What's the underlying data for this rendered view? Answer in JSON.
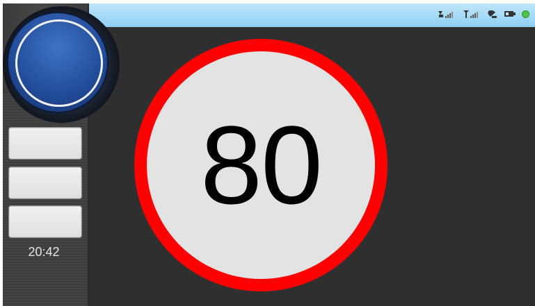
{
  "status_bar": {
    "icons": [
      "satellite-signal-icon",
      "antenna-signal-icon",
      "satellite-dish-icon",
      "battery-icon",
      "gps-fix-dot-icon"
    ],
    "gps_color": "#4fc24a",
    "background": "#8ecff3"
  },
  "sidebar": {
    "home_button_icon": "circle-ring-icon",
    "buttons": [
      "",
      "",
      ""
    ],
    "clock": "20:42"
  },
  "speed_limit": {
    "value": "80",
    "ring_color": "#ff0000",
    "face_color": "#e3e3e3"
  }
}
